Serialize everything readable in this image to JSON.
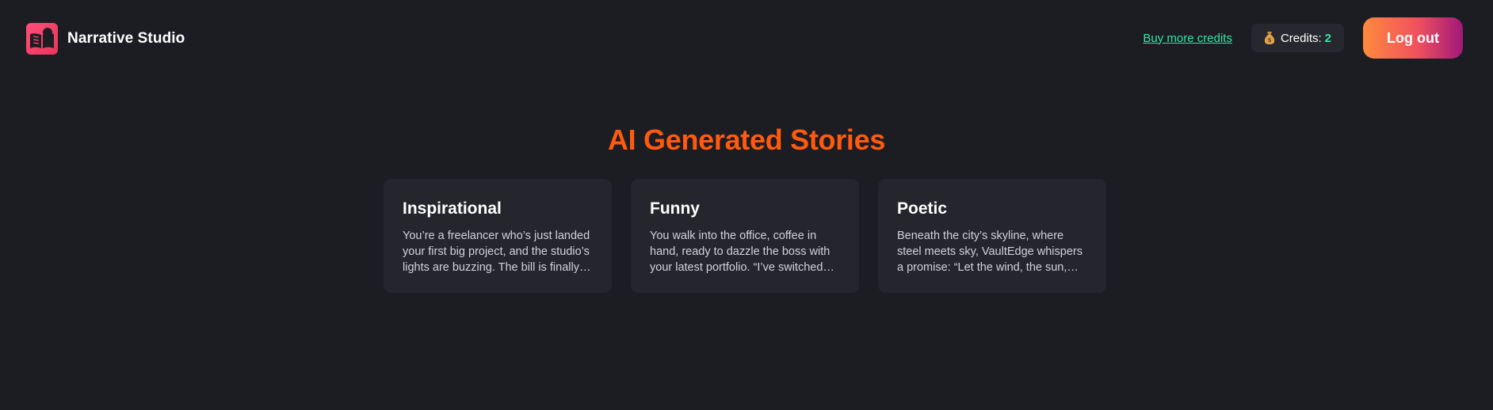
{
  "header": {
    "brand_name": "Narrative Studio",
    "logo_icon": "book-speech-logo-icon",
    "buy_credits_label": "Buy more credits",
    "credits_label": "Credits:",
    "credits_value": "2",
    "credits_icon": "money-bag-icon",
    "logout_label": "Log out"
  },
  "main": {
    "title": "AI Generated Stories",
    "cards": [
      {
        "title": "Inspirational",
        "excerpt": "You’re a freelancer who’s just landed your first big project, and the studio’s lights are buzzing. The bill is finally paid and the future feels bright."
      },
      {
        "title": "Funny",
        "excerpt": "You walk into the office, coffee in hand, ready to dazzle the boss with your latest portfolio. “I’ve switched everything to VaultEdge,” you announce."
      },
      {
        "title": "Poetic",
        "excerpt": "Beneath the city’s skyline, where steel meets sky, VaultEdge whispers a promise: “Let the wind, the sun, and the rain keep their secrets.”"
      }
    ]
  },
  "colors": {
    "background": "#1c1d23",
    "card_background": "#25262d",
    "title_accent": "#ff5a10",
    "link_accent": "#2ee6a6",
    "logout_gradient_start": "#ff8a3d",
    "logout_gradient_end": "#a0187a",
    "logo_color": "#ff4e7a"
  }
}
